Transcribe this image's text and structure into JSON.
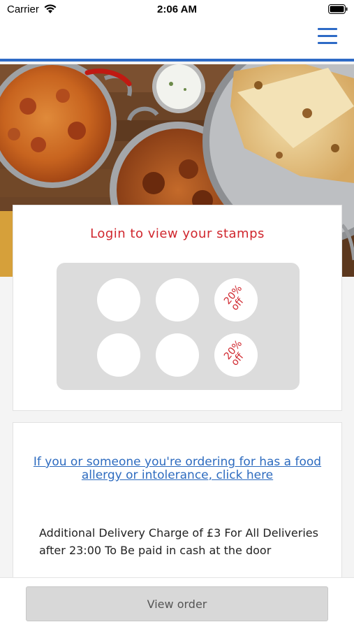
{
  "status_bar": {
    "carrier": "Carrier",
    "time": "2:06 AM"
  },
  "navbar": {
    "menu_icon": "hamburger-menu-icon",
    "accent_color": "#2e6bc6"
  },
  "hero": {
    "icon": "food-banner-image"
  },
  "loyalty": {
    "title": "Login to view your stamps",
    "title_color": "#d0262d",
    "stamps": [
      {
        "reward": ""
      },
      {
        "reward": ""
      },
      {
        "reward_line1": "20%",
        "reward_line2": "off"
      },
      {
        "reward": ""
      },
      {
        "reward": ""
      },
      {
        "reward_line1": "20%",
        "reward_line2": "off"
      }
    ]
  },
  "info": {
    "allergy_link_line1": "If you or someone you're ordering for has a food",
    "allergy_link_line2": "allergy or intolerance, click here",
    "delivery_line1": "Additional Delivery Charge of £3 For All Deliveries",
    "delivery_line2": "after 23:00 To Be paid in cash at the door",
    "link_color": "#2d6bbf"
  },
  "footer": {
    "view_order_label": "View order"
  }
}
